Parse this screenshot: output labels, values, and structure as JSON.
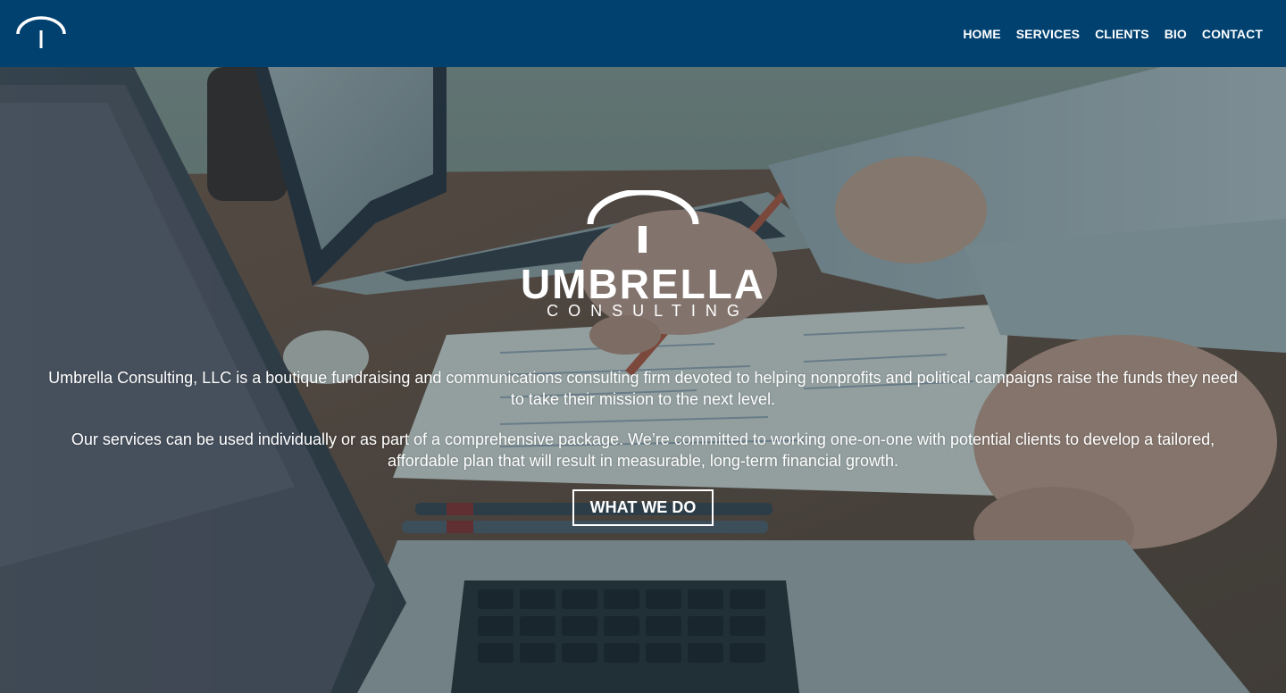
{
  "header": {
    "logo_icon": "umbrella-icon",
    "nav": [
      {
        "label": "HOME"
      },
      {
        "label": "SERVICES"
      },
      {
        "label": "CLIENTS"
      },
      {
        "label": "BIO"
      },
      {
        "label": "CONTACT"
      }
    ]
  },
  "hero": {
    "background_image": "desk-laptops-hands-photo",
    "brand": {
      "icon": "umbrella-icon",
      "name": "UMBRELLA",
      "subtitle": "CONSULTING"
    },
    "paragraphs": [
      "Umbrella Consulting, LLC is a boutique fundraising and communications consulting firm devoted to helping nonprofits and political campaigns raise the funds they need to take their mission to the next level.",
      "Our services can be used individually or as part of a comprehensive package. We’re committed to working one-on-one with potential clients to develop a tailored, affordable plan that will result in measurable, long-term financial growth."
    ],
    "cta_label": "WHAT WE DO"
  },
  "colors": {
    "header_bg": "#004170",
    "text": "#ffffff",
    "overlay": "#0f2d37"
  }
}
